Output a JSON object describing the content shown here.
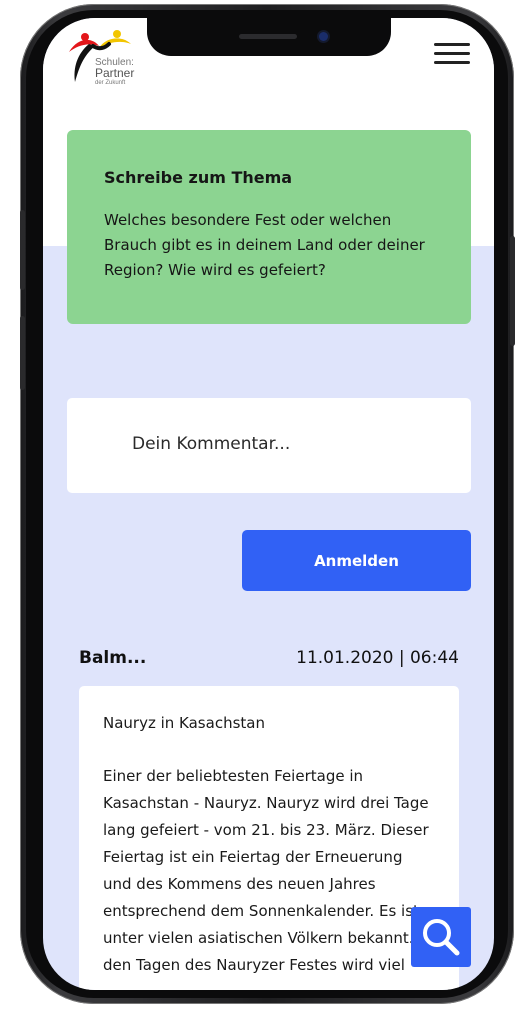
{
  "logo": {
    "line1": "Schulen:",
    "line2": "Partner",
    "line3": "der Zukunft"
  },
  "topic": {
    "title": "Schreibe zum Thema",
    "question": "Welches besondere Fest oder welchen Brauch gibt es in deinem Land oder deiner Region? Wie wird es gefeiert?"
  },
  "comment": {
    "placeholder": "Dein Kommentar..."
  },
  "login_button": "Anmelden",
  "post": {
    "author": "Balm...",
    "date": "11.01.2020 | 06:44",
    "title": "Nauryz in Kasachstan",
    "body": "Einer der beliebtesten Feiertage in Kasachstan - Nauryz. Nauryz wird drei Tage lang gefeiert - vom 21. bis 23. März. Dieser Feiertag ist ein Feiertag der Erneuerung und des Kommens des neuen Jahres entsprechend dem Sonnenkalender. Es ist unter vielen asiatischen Völkern bekannt. In den Tagen des Nauryzer Festes wird viel"
  },
  "icons": {
    "menu": "hamburger-menu-icon",
    "search": "search-icon"
  },
  "colors": {
    "topic_bg": "#8cd491",
    "accent": "#3161f5",
    "page_bg": "#dfe4fb"
  }
}
